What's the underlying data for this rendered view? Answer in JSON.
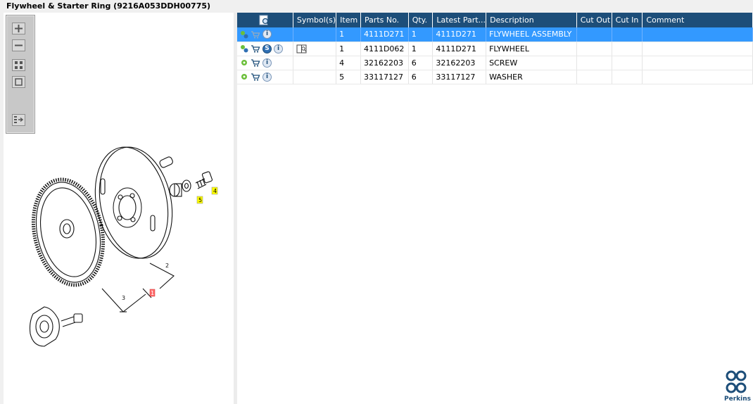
{
  "title": "Flywheel & Starter Ring (9216A053DDH00775)",
  "toolbar": {
    "zoom_in": "zoom-in",
    "zoom_out": "zoom-out",
    "fit": "fit-to-window",
    "actual": "actual-size",
    "export": "export"
  },
  "diagram": {
    "callouts": [
      "1",
      "2",
      "3",
      "4",
      "5"
    ],
    "highlight_colors": {
      "yellow": "#ffff00",
      "red": "#ff6b6b"
    }
  },
  "table": {
    "headers": [
      "",
      "Symbol(s)",
      "Item",
      "Parts No.",
      "Qty.",
      "Latest Part...",
      "Description",
      "Cut Out",
      "Cut In",
      "Comment"
    ],
    "rows": [
      {
        "item": "1",
        "parts_no": "4111D271",
        "qty": "1",
        "latest": "4111D271",
        "description": "FLYWHEEL ASSEMBLY",
        "cut_out": "",
        "cut_in": "",
        "comment": "",
        "selected": true
      },
      {
        "item": "1",
        "parts_no": "4111D062",
        "qty": "1",
        "latest": "4111D271",
        "description": "FLYWHEEL",
        "cut_out": "",
        "cut_in": "",
        "comment": "",
        "selected": false
      },
      {
        "item": "4",
        "parts_no": "32162203",
        "qty": "6",
        "latest": "32162203",
        "description": "SCREW",
        "cut_out": "",
        "cut_in": "",
        "comment": "",
        "selected": false
      },
      {
        "item": "5",
        "parts_no": "33117127",
        "qty": "6",
        "latest": "33117127",
        "description": "WASHER",
        "cut_out": "",
        "cut_in": "",
        "comment": "",
        "selected": false
      }
    ]
  },
  "brand": {
    "name": "Perkins",
    "color": "#1d4e79"
  },
  "colors": {
    "header": "#1d4e79",
    "selected": "#3399ff"
  }
}
